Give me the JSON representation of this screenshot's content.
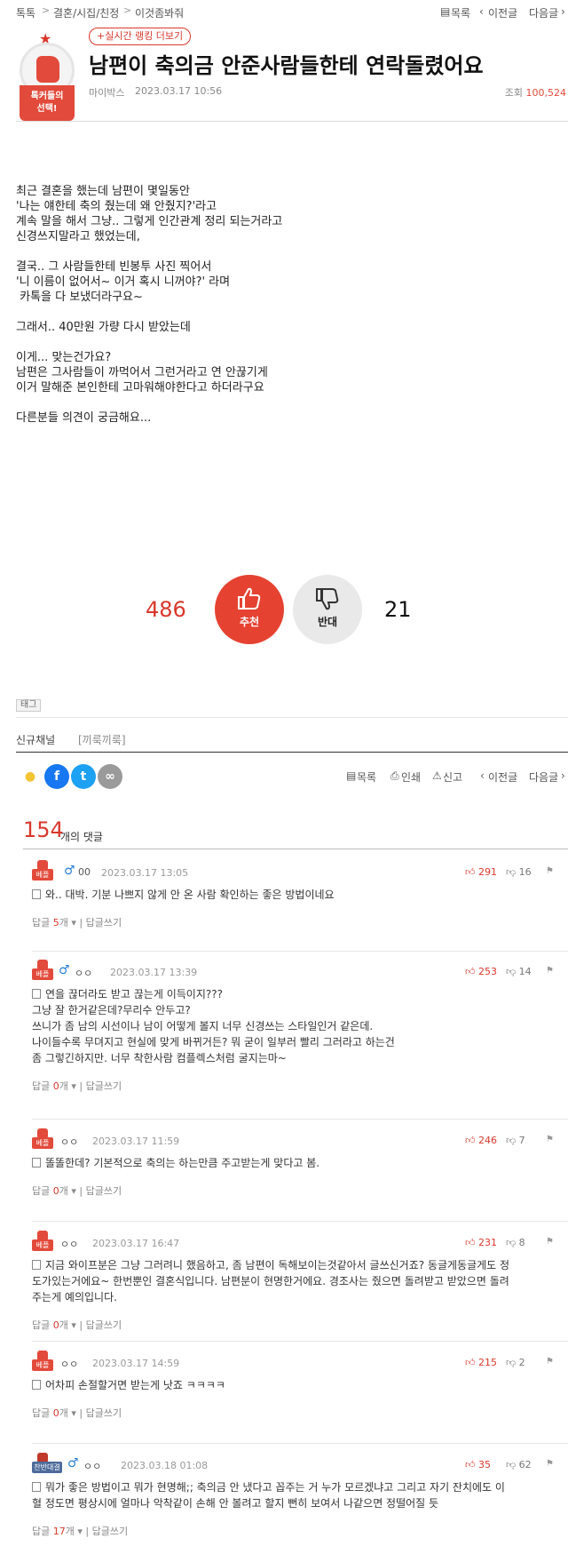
{
  "breadcrumb": [
    "톡톡",
    "결혼/시집/친정",
    "이것좀봐줘"
  ],
  "top_nav": {
    "list": "목록",
    "prev": "이전글",
    "next": "다음글"
  },
  "badge": {
    "line1": "톡커들의",
    "line2": "선택!"
  },
  "rank_pill": "실시간 랭킹 더보기",
  "post": {
    "title": "남편이 축의금 안준사람들한테 연락돌렸어요",
    "author": "마이박스",
    "date": "2023.03.17 10:56",
    "views_label": "조회",
    "views": "100,524"
  },
  "body": [
    "최근 결혼을 했는데 남편이 몇일동안",
    "'나는 얘한테 축의 줬는데 왜 안줬지?'라고",
    "계속 말을 해서 그냥.. 그렇게 인간관계 정리 되는거라고",
    "신경쓰지말라고 했었는데,",
    "",
    "결국.. 그 사람들한테 빈봉투 사진 찍어서",
    "'니 이름이 없어서~ 이거 혹시 니꺼야?' 라며",
    " 카톡을 다 보냈더라구요~",
    "",
    "그래서.. 40만원 가량 다시 받았는데",
    "",
    "이게... 맞는건가요?",
    "남편은 그사람들이 까먹어서 그런거라고 연 안끊기게",
    "이거 말해준 본인한테 고마워해야한다고 하더라구요",
    "",
    "다른분들 의견이 궁금해요..."
  ],
  "vote": {
    "up_count": "486",
    "up_label": "추천",
    "down_label": "반대",
    "down_count": "21"
  },
  "tag_label": "태그",
  "channel": {
    "label": "신규채널",
    "value": "[끼룩끼룩]"
  },
  "share_actions": {
    "list": "목록",
    "print": "인쇄",
    "report": "신고",
    "prev": "이전글",
    "next": "다음글"
  },
  "comments_header": {
    "count": "154",
    "label": "개의 댓글"
  },
  "comment_labels": {
    "reply": "답글",
    "reply_unit": "개",
    "write": "답글쓰기"
  },
  "comments": [
    {
      "badge": "베플",
      "gender": "♂",
      "nick": "00",
      "date": "2023.03.17 13:05",
      "up": "291",
      "down": "16",
      "lines": [
        "와.. 대박. 기분 나쁘지 않게 안 온 사람 확인하는 좋은 방법이네요"
      ],
      "replies": "5"
    },
    {
      "badge": "베플",
      "gender": "♂",
      "nick": "ㅇㅇ",
      "date": "2023.03.17 13:39",
      "up": "253",
      "down": "14",
      "lines": [
        "연을 끊더라도 받고 끊는게 이득이지???",
        "그냥 잘 한거같은데?무리수 안두고?",
        "쓰니가 좀 남의 시선이나 남이 어떻게 볼지 너무 신경쓰는 스타일인거 같은데.",
        "나이들수록 무뎌지고 현실에 맞게 바뀌거든? 뭐 굳이 일부러 빨리 그러라고 하는건",
        "좀 그렇긴하지만. 너무 착한사람 컴플렉스처럼 굴지는마~"
      ],
      "replies": "0"
    },
    {
      "badge": "베플",
      "gender": "",
      "nick": "ㅇㅇ",
      "date": "2023.03.17 11:59",
      "up": "246",
      "down": "7",
      "lines": [
        "똘똘한데? 기본적으로 축의는 하는만큼 주고받는게 맞다고 봄."
      ],
      "replies": "0"
    },
    {
      "badge": "베플",
      "gender": "",
      "nick": "ㅇㅇ",
      "date": "2023.03.17 16:47",
      "up": "231",
      "down": "8",
      "lines": [
        "지금 와이프분은 그냥 그러려니 했음하고, 좀 남편이 독해보이는것같아서 글쓰신거죠? 동글게동글게도 정",
        "도가있는거에요~ 한번뿐인 결혼식입니다. 남편분이 현명한거에요. 경조사는 줬으면 돌려받고 받았으면 돌려",
        "주는게 예의입니다."
      ],
      "replies": "0"
    },
    {
      "badge": "베플",
      "gender": "",
      "nick": "ㅇㅇ",
      "date": "2023.03.17 14:59",
      "up": "215",
      "down": "2",
      "lines": [
        "어차피 손절할거면 받는게 낫죠 ㅋㅋㅋㅋ"
      ],
      "replies": "0"
    },
    {
      "badge": "찬반대결",
      "gender": "♂",
      "nick": "ㅇㅇ",
      "date": "2023.03.18 01:08",
      "up": "35",
      "down": "62",
      "lines": [
        "뭐가 좋은 방법이고 뭐가 현명해;; 축의금 안 냈다고 꼽주는 거 누가 모르겠냐고 그리고 자기 잔치에도 이",
        "혈 정도면 평상시에 얼마나 악착같이 손해 안 볼려고 할지 뻔히 보여서 나같으면 정떨어질 듯"
      ],
      "replies": "17"
    }
  ]
}
